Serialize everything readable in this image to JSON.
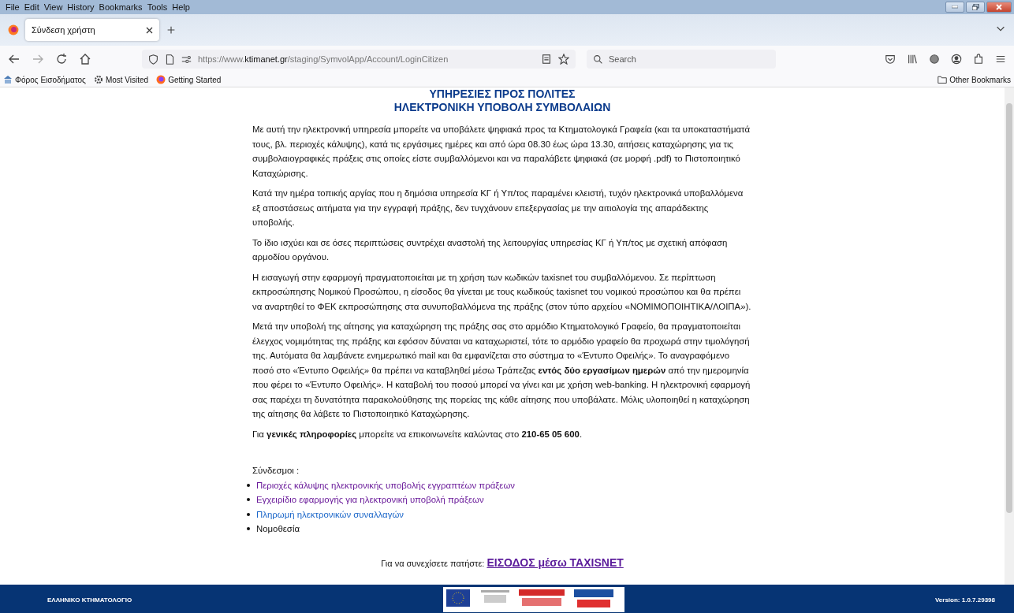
{
  "menu_bar": [
    "File",
    "Edit",
    "View",
    "History",
    "Bookmarks",
    "Tools",
    "Help"
  ],
  "tab": {
    "title": "Σύνδεση χρήστη",
    "selected": true
  },
  "address_bar": {
    "prefix": "https://www.",
    "domain": "ktimanet.gr",
    "path": "/staging/SymvolApp/Account/LoginCitizen"
  },
  "search": {
    "placeholder": "Search"
  },
  "bookmarks": [
    {
      "label": "Φόρος Εισοδήματος",
      "kind": "site"
    },
    {
      "label": "Most Visited",
      "kind": "gear"
    },
    {
      "label": "Getting Started",
      "kind": "firefox"
    }
  ],
  "other_bookmarks": "Other Bookmarks",
  "page": {
    "title_lines": [
      "ΥΠΗΡΕΣΙΕΣ ΠΡΟΣ ΠΟΛΙΤΕΣ",
      "ΗΛΕΚΤΡΟΝΙΚΗ ΥΠΟΒΟΛΗ ΣΥΜΒΟΛΑΙΩΝ"
    ],
    "paragraphs": [
      "Με αυτή την ηλεκτρονική υπηρεσία μπορείτε να υποβάλετε ψηφιακά προς τα Κτηματολογικά Γραφεία (και τα υποκαταστήματά τους, βλ. περιοχές κάλυψης), κατά τις εργάσιμες ημέρες και από ώρα 08.30 έως ώρα 13.30, αιτήσεις καταχώρησης για τις συμβολαιογραφικές πράξεις στις οποίες είστε συμβαλλόμενοι και να παραλάβετε ψηφιακά (σε μορφή .pdf) το Πιστοποιητικό Καταχώρισης.",
      "Κατά την ημέρα τοπικής αργίας που η δημόσια υπηρεσία ΚΓ ή Υπ/τος παραμένει κλειστή, τυχόν ηλεκτρονικά υποβαλλόμενα εξ αποστάσεως αιτήματα για την εγγραφή πράξης, δεν τυγχάνουν επεξεργασίας με την αιτιολογία της απαράδεκτης υποβολής.",
      "Το ίδιο ισχύει και σε όσες περιπτώσεις συντρέχει αναστολή της λειτουργίας υπηρεσίας ΚΓ ή Υπ/τος με σχετική απόφαση αρμοδίου οργάνου.",
      "Η εισαγωγή στην εφαρμογή πραγματοποιείται με τη χρήση των κωδικών taxisnet του συμβαλλόμενου. Σε περίπτωση εκπροσώπησης Νομικού Προσώπου, η είσοδος θα γίνεται με τους κωδικούς taxisnet του νομικού προσώπου και θα πρέπει να αναρτηθεί το ΦΕΚ εκπροσώπησης στα συνυποβαλλόμενα της πράξης (στον τύπο αρχείου «ΝΟΜΙΜΟΠΟΙΗΤΙΚΑ/ΛΟΙΠΑ»).",
      "Μετά την υποβολή της αίτησης για καταχώρηση της πράξης σας στο αρμόδιο Κτηματολογικό Γραφείο, θα πραγματοποιείται έλεγχος νομιμότητας της πράξης και εφόσον δύναται να καταχωριστεί, τότε το αρμόδιο γραφείο θα προχωρά στην τιμολόγησή της. Αυτόματα θα λαμβάνετε ενημερωτικό mail και θα εμφανίζεται στο σύστημα το «Έντυπο Οφειλής». Το αναγραφόμενο ποσό στο «Έντυπο Οφειλής» θα πρέπει να καταβληθεί μέσω Τράπεζας **εντός δύο εργασίμων ημερών** από την ημερομηνία που φέρει το «Έντυπο Οφειλής». Η καταβολή του ποσού μπορεί να γίνει και με χρήση web-banking. Η ηλεκτρονική εφαρμογή σας παρέχει τη δυνατότητα παρακολούθησης της πορείας της κάθε αίτησης που υποβάλατε. Μόλις υλοποιηθεί η καταχώρηση της αίτησης θα λάβετε το Πιστοποιητικό Καταχώρησης.",
      "Για **γενικές πληροφορίες** μπορείτε να επικοινωνείτε καλώντας στο **210-65 05 600**."
    ],
    "links_heading": "Σύνδεσμοι :",
    "links": [
      {
        "label": "Περιοχές κάλυψης ηλεκτρονικής υποβολής εγγραπτέων πράξεων",
        "kind": "visited"
      },
      {
        "label": "Εγχειρίδιο εφαρμογής για ηλεκτρονική υποβολή πράξεων",
        "kind": "visited"
      },
      {
        "label": "Πληρωμή ηλεκτρονικών συναλλαγών",
        "kind": "link"
      },
      {
        "label": "Νομοθεσία",
        "kind": "plain"
      }
    ],
    "continue_text": "Για να συνεχίσετε πατήστε:",
    "login_link": "ΕΙΣΟΔΟΣ μέσω TAXISNET"
  },
  "footer": {
    "left": "ΕΛΛΗΝΙΚΟ ΚΤΗΜΑΤΟΛΟΓΙΟ",
    "version": "Version: 1.0.7.29398"
  }
}
